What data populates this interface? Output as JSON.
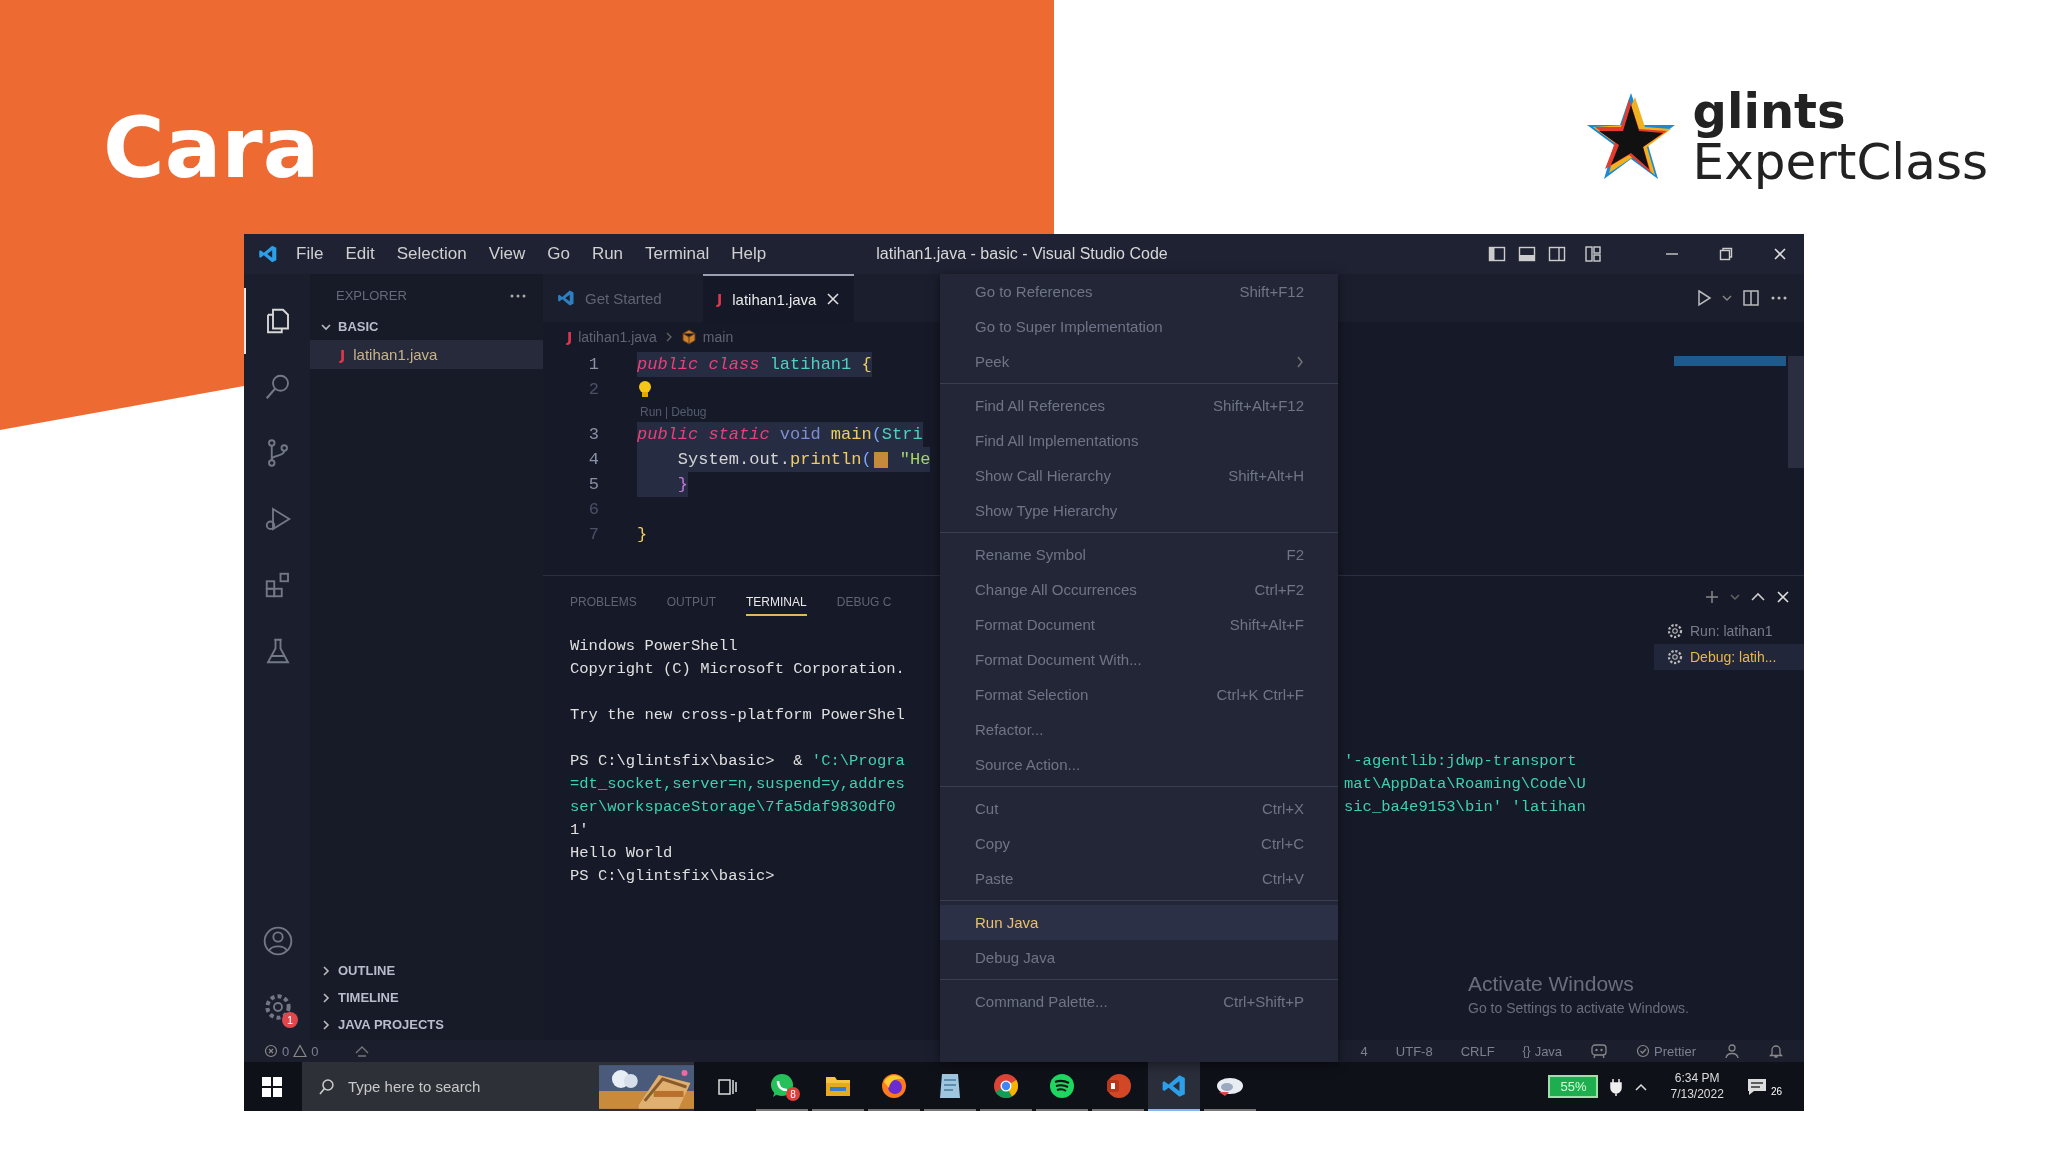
{
  "slide": {
    "title": "Cara",
    "brand": {
      "line1": "glints",
      "line2": "ExpertClass"
    }
  },
  "window": {
    "title": "latihan1.java - basic - Visual Studio Code",
    "menu": [
      "File",
      "Edit",
      "Selection",
      "View",
      "Go",
      "Run",
      "Terminal",
      "Help"
    ]
  },
  "activity_bar": {
    "items": [
      {
        "kind": "files",
        "selected": true
      },
      {
        "kind": "search",
        "selected": false
      },
      {
        "kind": "source-control",
        "selected": false
      },
      {
        "kind": "run-debug",
        "selected": false
      },
      {
        "kind": "extensions",
        "selected": false
      },
      {
        "kind": "testing",
        "selected": false
      }
    ],
    "settings": {
      "badge": "1"
    }
  },
  "sidebar": {
    "title": "EXPLORER",
    "folder": {
      "label": "BASIC",
      "expanded": true,
      "children": [
        {
          "icon": "J",
          "label": "latihan1.java",
          "selected": true
        }
      ]
    },
    "sections": [
      {
        "label": "OUTLINE",
        "expanded": false
      },
      {
        "label": "TIMELINE",
        "expanded": false
      },
      {
        "label": "JAVA PROJECTS",
        "expanded": false
      }
    ]
  },
  "tabs": [
    {
      "kind": "welcome",
      "label": "Get Started",
      "selected": false
    },
    {
      "kind": "java",
      "icon": "J",
      "label": "latihan1.java",
      "selected": true
    }
  ],
  "breadcrumb": [
    {
      "kind": "file",
      "icon": "J",
      "label": "latihan1.java"
    },
    {
      "kind": "method",
      "label": "main"
    }
  ],
  "editor": {
    "lines": [
      {
        "kind": "code",
        "number": "1",
        "selected": true,
        "tokens": [
          {
            "text": "public class ",
            "kind": "keyword"
          },
          {
            "text": "latihan1",
            "kind": "class"
          },
          {
            "text": " {",
            "kind": "brace"
          }
        ]
      },
      {
        "kind": "lightbulb",
        "number": "2",
        "selected": false
      },
      {
        "kind": "codelens",
        "links": [
          "Run",
          "Debug"
        ],
        "separator": "|"
      },
      {
        "kind": "code",
        "number": "3",
        "selected": true,
        "tokens": [
          {
            "text": "public static ",
            "kind": "keyword"
          },
          {
            "text": "void ",
            "kind": "type"
          },
          {
            "text": "main",
            "kind": "method"
          },
          {
            "text": "(",
            "kind": "paren"
          },
          {
            "text": "Stri",
            "kind": "class"
          }
        ]
      },
      {
        "kind": "code",
        "number": "4",
        "selected": true,
        "tokens": [
          {
            "text": "    System.out.",
            "kind": "plain"
          },
          {
            "text": "println",
            "kind": "method"
          },
          {
            "text": "(",
            "kind": "paren"
          },
          {
            "kind": "hint"
          },
          {
            "text": " \"He",
            "kind": "string"
          }
        ]
      },
      {
        "kind": "code",
        "number": "5",
        "selected": true,
        "tokens": [
          {
            "text": "    }",
            "kind": "brace2"
          }
        ]
      },
      {
        "kind": "code",
        "number": "6",
        "selected": false
      },
      {
        "kind": "code",
        "number": "7",
        "selected": false,
        "tokens": [
          {
            "text": "}",
            "kind": "brace"
          }
        ]
      }
    ]
  },
  "panel": {
    "tabs": [
      {
        "label": "PROBLEMS",
        "selected": false
      },
      {
        "label": "OUTPUT",
        "selected": false
      },
      {
        "label": "TERMINAL",
        "selected": true
      },
      {
        "label": "DEBUG C",
        "selected": false
      }
    ],
    "terminal": [
      {
        "kind": "text",
        "segments": [
          {
            "text": "Windows PowerShell",
            "kind": "plain"
          }
        ]
      },
      {
        "kind": "text",
        "segments": [
          {
            "text": "Copyright (C) Microsoft Corporation.",
            "kind": "plain"
          }
        ]
      },
      {
        "kind": "blank"
      },
      {
        "kind": "text",
        "segments": [
          {
            "text": "Try the new cross-platform PowerShel",
            "kind": "plain"
          }
        ]
      },
      {
        "kind": "blank"
      },
      {
        "kind": "text",
        "segments": [
          {
            "text": "PS C:\\glintsfix\\basic>  & ",
            "kind": "plain"
          },
          {
            "text": "'C:\\Progra",
            "kind": "path"
          }
        ],
        "continued": "'-agentlib:jdwp-transport"
      },
      {
        "kind": "text",
        "segments": [
          {
            "text": "=dt_socket,server=n,suspend=y,addres",
            "kind": "path"
          }
        ],
        "continued": "mat\\AppData\\Roaming\\Code\\U"
      },
      {
        "kind": "text",
        "segments": [
          {
            "text": "ser\\workspaceStorage\\7fa5daf9830df0",
            "kind": "path"
          }
        ],
        "continued": "sic_ba4e9153\\bin' 'latihan"
      },
      {
        "kind": "text",
        "segments": [
          {
            "text": "1'",
            "kind": "plain"
          }
        ]
      },
      {
        "kind": "text",
        "segments": [
          {
            "text": "Hello World",
            "kind": "plain"
          }
        ]
      },
      {
        "kind": "text",
        "segments": [
          {
            "text": "PS C:\\glintsfix\\basic>",
            "kind": "plain"
          }
        ]
      }
    ],
    "terminals": [
      {
        "label": "Run: latihan1",
        "selected": false
      },
      {
        "label": "Debug: latih...",
        "selected": true
      }
    ]
  },
  "context_menu": {
    "groups": [
      [
        {
          "label": "Go to References",
          "shortcut": "Shift+F12",
          "submenu": false,
          "selected": false
        },
        {
          "label": "Go to Super Implementation",
          "submenu": false,
          "selected": false
        },
        {
          "label": "Peek",
          "submenu": true,
          "selected": false
        }
      ],
      [
        {
          "label": "Find All References",
          "shortcut": "Shift+Alt+F12",
          "submenu": false,
          "selected": false
        },
        {
          "label": "Find All Implementations",
          "submenu": false,
          "selected": false
        },
        {
          "label": "Show Call Hierarchy",
          "shortcut": "Shift+Alt+H",
          "submenu": false,
          "selected": false
        },
        {
          "label": "Show Type Hierarchy",
          "submenu": false,
          "selected": false
        }
      ],
      [
        {
          "label": "Rename Symbol",
          "shortcut": "F2",
          "submenu": false,
          "selected": false
        },
        {
          "label": "Change All Occurrences",
          "shortcut": "Ctrl+F2",
          "submenu": false,
          "selected": false
        },
        {
          "label": "Format Document",
          "shortcut": "Shift+Alt+F",
          "submenu": false,
          "selected": false
        },
        {
          "label": "Format Document With...",
          "submenu": false,
          "selected": false
        },
        {
          "label": "Format Selection",
          "shortcut": "Ctrl+K Ctrl+F",
          "submenu": false,
          "selected": false
        },
        {
          "label": "Refactor...",
          "submenu": false,
          "selected": false
        },
        {
          "label": "Source Action...",
          "submenu": false,
          "selected": false
        }
      ],
      [
        {
          "label": "Cut",
          "shortcut": "Ctrl+X",
          "submenu": false,
          "selected": false
        },
        {
          "label": "Copy",
          "shortcut": "Ctrl+C",
          "submenu": false,
          "selected": false
        },
        {
          "label": "Paste",
          "shortcut": "Ctrl+V",
          "submenu": false,
          "selected": false
        }
      ],
      [
        {
          "label": "Run Java",
          "submenu": false,
          "selected": true
        },
        {
          "label": "Debug Java",
          "submenu": false,
          "selected": false
        }
      ],
      [
        {
          "label": "Command Palette...",
          "shortcut": "Ctrl+Shift+P",
          "submenu": false,
          "selected": false
        }
      ]
    ]
  },
  "activation": {
    "title": "Activate Windows",
    "subtitle": "Go to Settings to activate Windows."
  },
  "status_bar": {
    "errors": "0",
    "warnings": "0",
    "right": [
      {
        "kind": "text",
        "label": "4"
      },
      {
        "kind": "text",
        "label": "UTF-8"
      },
      {
        "kind": "text",
        "label": "CRLF"
      },
      {
        "kind": "language",
        "icon": "{}",
        "label": "Java"
      },
      {
        "kind": "feedback"
      },
      {
        "kind": "check",
        "label": "Prettier"
      },
      {
        "kind": "account"
      },
      {
        "kind": "bell"
      }
    ]
  },
  "taskbar": {
    "search_placeholder": "Type here to search",
    "apps": [
      {
        "kind": "chat",
        "badge": "8",
        "active": false
      },
      {
        "kind": "folder",
        "active": false
      },
      {
        "kind": "flame-globe",
        "active": false
      },
      {
        "kind": "notepad",
        "active": false
      },
      {
        "kind": "ring",
        "active": false
      },
      {
        "kind": "sound-wave",
        "active": false
      },
      {
        "kind": "slides",
        "active": false
      },
      {
        "kind": "ribbon",
        "active": true
      },
      {
        "kind": "cloud",
        "active": false
      }
    ],
    "battery": "55%",
    "time": "6:34 PM",
    "date": "7/13/2022",
    "notifications": "26"
  }
}
